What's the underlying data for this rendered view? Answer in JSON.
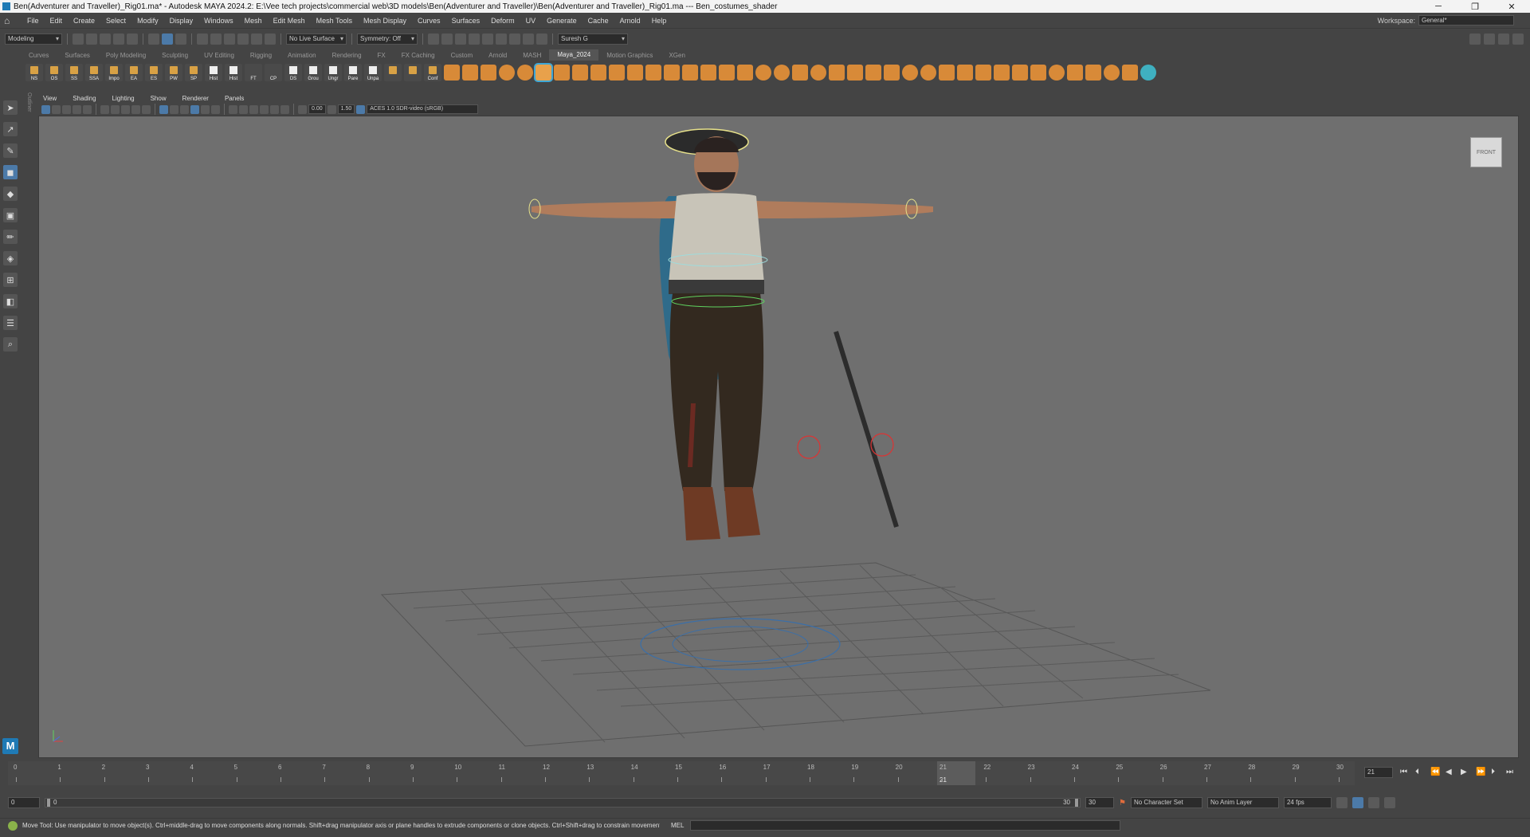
{
  "window": {
    "title": "Ben(Adventurer and Traveller)_Rig01.ma* - Autodesk MAYA 2024.2: E:\\Vee tech projects\\commercial web\\3D models\\Ben(Adventurer and Traveller)\\Ben(Adventurer and Traveller)_Rig01.ma  ---  Ben_costumes_shader",
    "minimize": "─",
    "maximize": "❐",
    "close": "✕"
  },
  "menubar": {
    "items": [
      "File",
      "Edit",
      "Create",
      "Select",
      "Modify",
      "Display",
      "Windows",
      "Mesh",
      "Edit Mesh",
      "Mesh Tools",
      "Mesh Display",
      "Curves",
      "Surfaces",
      "Deform",
      "UV",
      "Generate",
      "Cache",
      "Arnold",
      "Help"
    ],
    "workspace_label": "Workspace:",
    "workspace_value": "General*"
  },
  "statusline": {
    "mode": "Modeling",
    "live_surface": "No Live Surface",
    "symmetry": "Symmetry: Off",
    "user": "Suresh G"
  },
  "shelf": {
    "tabs": [
      "Curves",
      "Surfaces",
      "Poly Modeling",
      "Sculpting",
      "UV Editing",
      "Rigging",
      "Animation",
      "Rendering",
      "FX",
      "FX Caching",
      "Custom",
      "Arnold",
      "MASH",
      "Maya_2024",
      "Motion Graphics",
      "XGen"
    ],
    "active_tab": "Maya_2024",
    "buttons": [
      "NS",
      "OS",
      "SS",
      "SSA",
      "Impo",
      "EA",
      "ES",
      "PW",
      "SP",
      "Hist",
      "Hist",
      "FT",
      "CP",
      "DS",
      "Grou",
      "Ungr",
      "Pare",
      "Unpa",
      "",
      "",
      "Conf"
    ]
  },
  "viewport": {
    "menu": [
      "View",
      "Shading",
      "Lighting",
      "Show",
      "Renderer",
      "Panels"
    ],
    "exposure": "0.00",
    "gamma": "1.50",
    "color_space": "ACES 1.0 SDR-video (sRGB)",
    "viewcube_label": "FRONT",
    "outliner_label": "Outliner"
  },
  "timeline": {
    "frames": [
      "0",
      "1",
      "2",
      "3",
      "4",
      "5",
      "6",
      "7",
      "8",
      "9",
      "10",
      "11",
      "12",
      "13",
      "14",
      "15",
      "16",
      "17",
      "18",
      "19",
      "20",
      "21",
      "22",
      "23",
      "24",
      "25",
      "26",
      "27",
      "28",
      "29",
      "30"
    ],
    "current_frame": "21",
    "current_frame_field": "21"
  },
  "range": {
    "start": "0",
    "inner_start": "0",
    "inner_end": "30",
    "end": "30",
    "character_set": "No Character Set",
    "anim_layer": "No Anim Layer",
    "fps": "24 fps"
  },
  "helpline": {
    "message": "Move Tool: Use manipulator to move object(s). Ctrl+middle-drag to move components along normals. Shift+drag manipulator axis or plane handles to extrude components or clone objects. Ctrl+Shift+drag to constrain movement to a co",
    "mel_label": "MEL"
  },
  "logo": "M"
}
